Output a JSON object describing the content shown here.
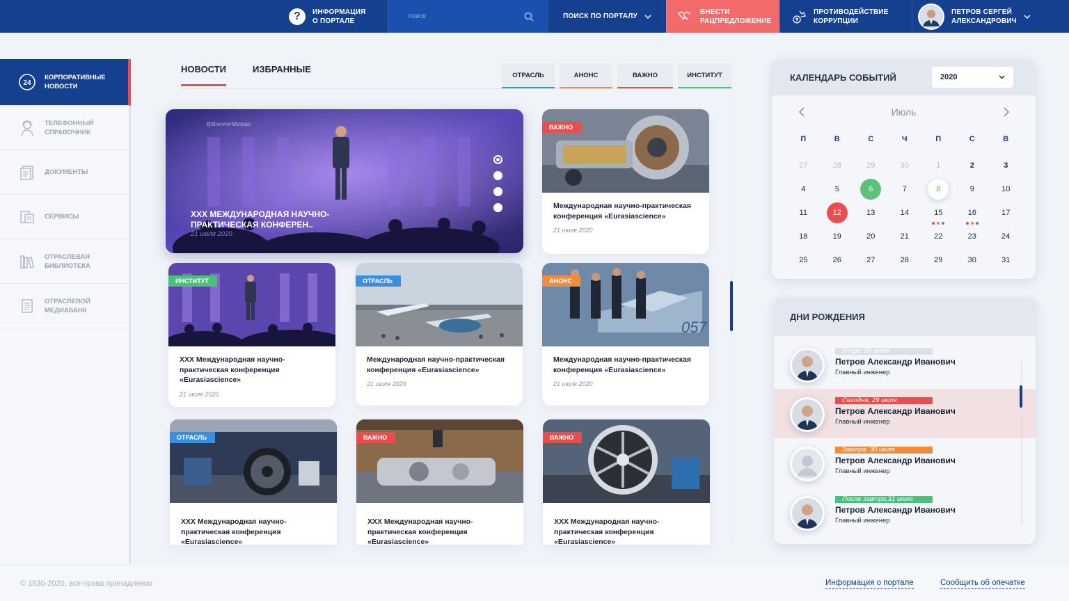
{
  "header": {
    "info_line1": "Информация",
    "info_line2": "о портале",
    "search_placeholder": "поиск",
    "portal_search": "Поиск по порталу",
    "rac_line1": "Внести",
    "rac_line2": "рацпредложение",
    "corr_line1": "Противодействие",
    "corr_line2": "коррупции",
    "user_line1": "Петров Сергей",
    "user_line2": "Александрович",
    "colors": {
      "bar": "#14408f",
      "search": "#1b4fb0",
      "accent": "#f26a6a"
    }
  },
  "sidebar": {
    "items": [
      {
        "line1": "Корпоративные",
        "line2": "новости",
        "icon": "news-24-icon"
      },
      {
        "line1": "Телефонный",
        "line2": "справочник",
        "icon": "operator-icon"
      },
      {
        "line1": "Документы",
        "line2": "",
        "icon": "documents-icon"
      },
      {
        "line1": "Сервисы",
        "line2": "",
        "icon": "services-icon"
      },
      {
        "line1": "Отраслевая",
        "line2": "библиотека",
        "icon": "library-icon"
      },
      {
        "line1": "Отраслевой",
        "line2": "медиабанк",
        "icon": "mediabank-icon"
      }
    ]
  },
  "tabs": [
    "Новости",
    "Избранные"
  ],
  "filters": [
    {
      "label": "Отрасль",
      "color": "#3a8fe0"
    },
    {
      "label": "Анонс",
      "color": "#f08c3c"
    },
    {
      "label": "Важно",
      "color": "#e84e4e"
    },
    {
      "label": "Институт",
      "color": "#4cbf7a"
    }
  ],
  "hero": {
    "title": "XXX Международная научно-практическая конферен..",
    "date": "21 июля 2020",
    "watermark": "@BrennerMichael"
  },
  "cards": [
    {
      "badge": "Важно",
      "badge_color": "#e84e4e",
      "title": "Международная научно-практическая конференция «Eurasiascience»",
      "date": "21 июля 2020"
    },
    {
      "badge": "Институт",
      "badge_color": "#4cbf7a",
      "title": "XXX Международная научно-практическая конференция «Eurasiascience»",
      "date": "21 июля 2020"
    },
    {
      "badge": "Отрасль",
      "badge_color": "#3a8fe0",
      "title": "Международная научно-практическая конференция «Eurasiascience»",
      "date": "21 июля 2020"
    },
    {
      "badge": "Анонс",
      "badge_color": "#f08c3c",
      "title": "Международная научно-практическая конференция «Eurasiascience»",
      "date": "21 июля 2020"
    },
    {
      "badge": "Отрасль",
      "badge_color": "#3a8fe0",
      "title": "XXX Международная научно-практическая конференция «Eurasiascience»",
      "date": ""
    },
    {
      "badge": "Важно",
      "badge_color": "#e84e4e",
      "title": "XXX Международная научно-практическая конференция «Eurasiascience»",
      "date": ""
    },
    {
      "badge": "Важно",
      "badge_color": "#e84e4e",
      "title": "XXX Международная научно-практическая конференция «Eurasiascience»",
      "date": ""
    }
  ],
  "calendar": {
    "title": "Календарь событий",
    "year": "2020",
    "month": "Июль",
    "weekdays": [
      "П",
      "В",
      "С",
      "Ч",
      "П",
      "С",
      "В"
    ],
    "weeks": [
      [
        "27",
        "28",
        "29",
        "30",
        "1",
        "2",
        "3"
      ],
      [
        "4",
        "5",
        "6",
        "7",
        "8",
        "9",
        "10"
      ],
      [
        "11",
        "12",
        "13",
        "14",
        "15",
        "16",
        "17"
      ],
      [
        "18",
        "19",
        "20",
        "21",
        "22",
        "23",
        "24"
      ],
      [
        "25",
        "26",
        "27",
        "28",
        "29",
        "30",
        "31"
      ]
    ],
    "highlight_green": "6",
    "highlight_today": "8",
    "highlight_red": "12",
    "colors": {
      "green": "#5cc27a",
      "red": "#e84e4e"
    }
  },
  "birthdays": {
    "title": "Дни рождения",
    "items": [
      {
        "tag": "Вчера, 28 июля",
        "tag_color": "#dcdfe5",
        "name": "Петров Александр Иванович",
        "role": "Главный инженер"
      },
      {
        "tag": "Сегодня, 29 июля",
        "tag_color": "#e84e4e",
        "name": "Петров Александр Иванович",
        "role": "Главный инженер"
      },
      {
        "tag": "Завтра, 30 июля",
        "tag_color": "#f08c3c",
        "name": "Петров Александр Иванович",
        "role": "Главный инженер"
      },
      {
        "tag": "После завтра,31 июля",
        "tag_color": "#4cbf7a",
        "name": "Петров Александр Иванович",
        "role": "Главный инженер"
      }
    ]
  },
  "footer": {
    "copyright": "© 1930-2020, все права пренадлежат",
    "link1": "Информация о портале",
    "link2": "Сообщить об опечатке"
  }
}
